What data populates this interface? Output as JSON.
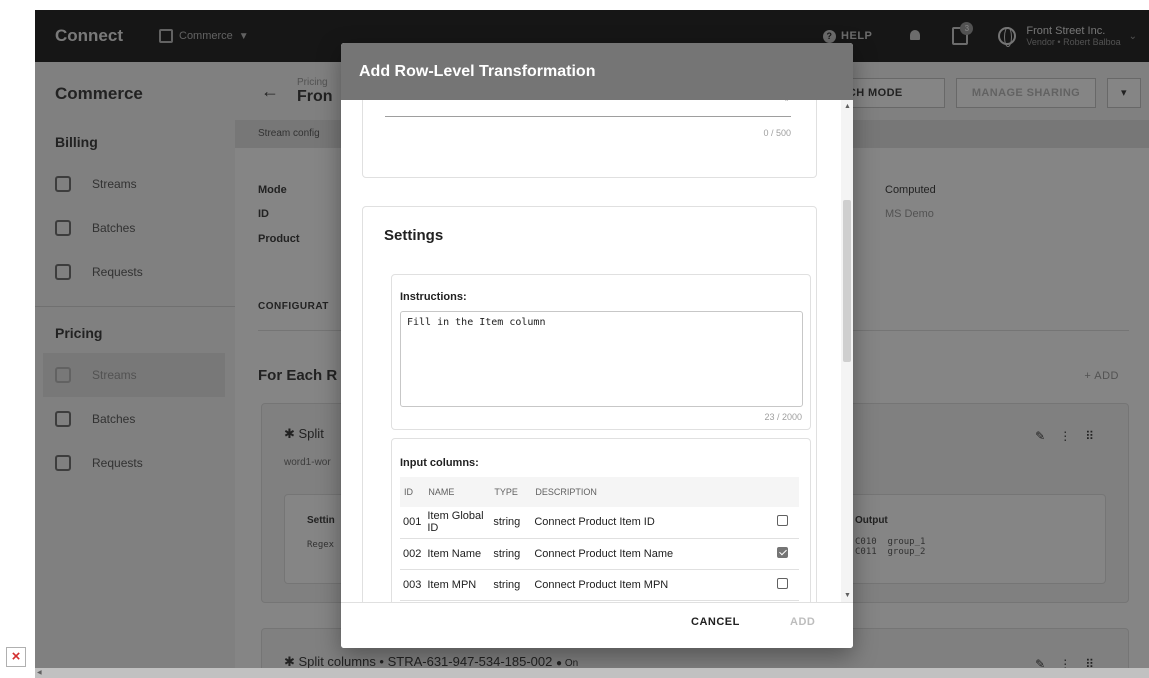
{
  "topbar": {
    "brand": "Connect",
    "module": "Commerce",
    "help": "HELP",
    "notification_count": "3",
    "org": "Front Street Inc.",
    "user": "Vendor • Robert Balboa"
  },
  "sidebar": {
    "title": "Commerce",
    "billing_label": "Billing",
    "billing_items": [
      "Streams",
      "Batches",
      "Requests"
    ],
    "pricing_label": "Pricing",
    "pricing_items": [
      "Streams",
      "Batches",
      "Requests"
    ]
  },
  "main": {
    "crumb_small": "Pricing",
    "crumb_big": "Fron",
    "switch_mode": "ITCH MODE",
    "manage_sharing": "MANAGE SHARING",
    "dropdown": "▾",
    "stream_config": "Stream config",
    "mode_label": "Mode",
    "id_label": "ID",
    "product_label": "Product",
    "computed": "Computed",
    "ms_demo": "MS Demo",
    "configuration_label": "CONFIGURAT",
    "for_each": "For Each R",
    "add": "+ ADD",
    "card1": {
      "title": "Split",
      "sub": "word1-wor",
      "settings": "Settin",
      "regex": "Regex",
      "output": "Output",
      "output_lines": "C010  group_1\nC011  group_2"
    },
    "card2": {
      "title": "Split columns • STRA-631-947-534-185-002",
      "status": "● On"
    }
  },
  "dialog": {
    "title": "Add Row-Level Transformation",
    "desc_counter": "0 / 500",
    "settings_title": "Settings",
    "instructions_label": "Instructions:",
    "instructions_value": "Fill in the Item column",
    "instructions_counter": "23 / 2000",
    "input_columns_label": "Input columns:",
    "table": {
      "headers": [
        "ID",
        "NAME",
        "TYPE",
        "DESCRIPTION"
      ],
      "rows": [
        {
          "id": "001",
          "name": "Item Global ID",
          "type": "string",
          "desc": "Connect Product Item ID",
          "checked": false
        },
        {
          "id": "002",
          "name": "Item Name",
          "type": "string",
          "desc": "Connect Product Item Name",
          "checked": true
        },
        {
          "id": "003",
          "name": "Item MPN",
          "type": "string",
          "desc": "Connect Product Item MPN",
          "checked": false
        }
      ]
    },
    "cancel": "CANCEL",
    "add": "ADD"
  }
}
